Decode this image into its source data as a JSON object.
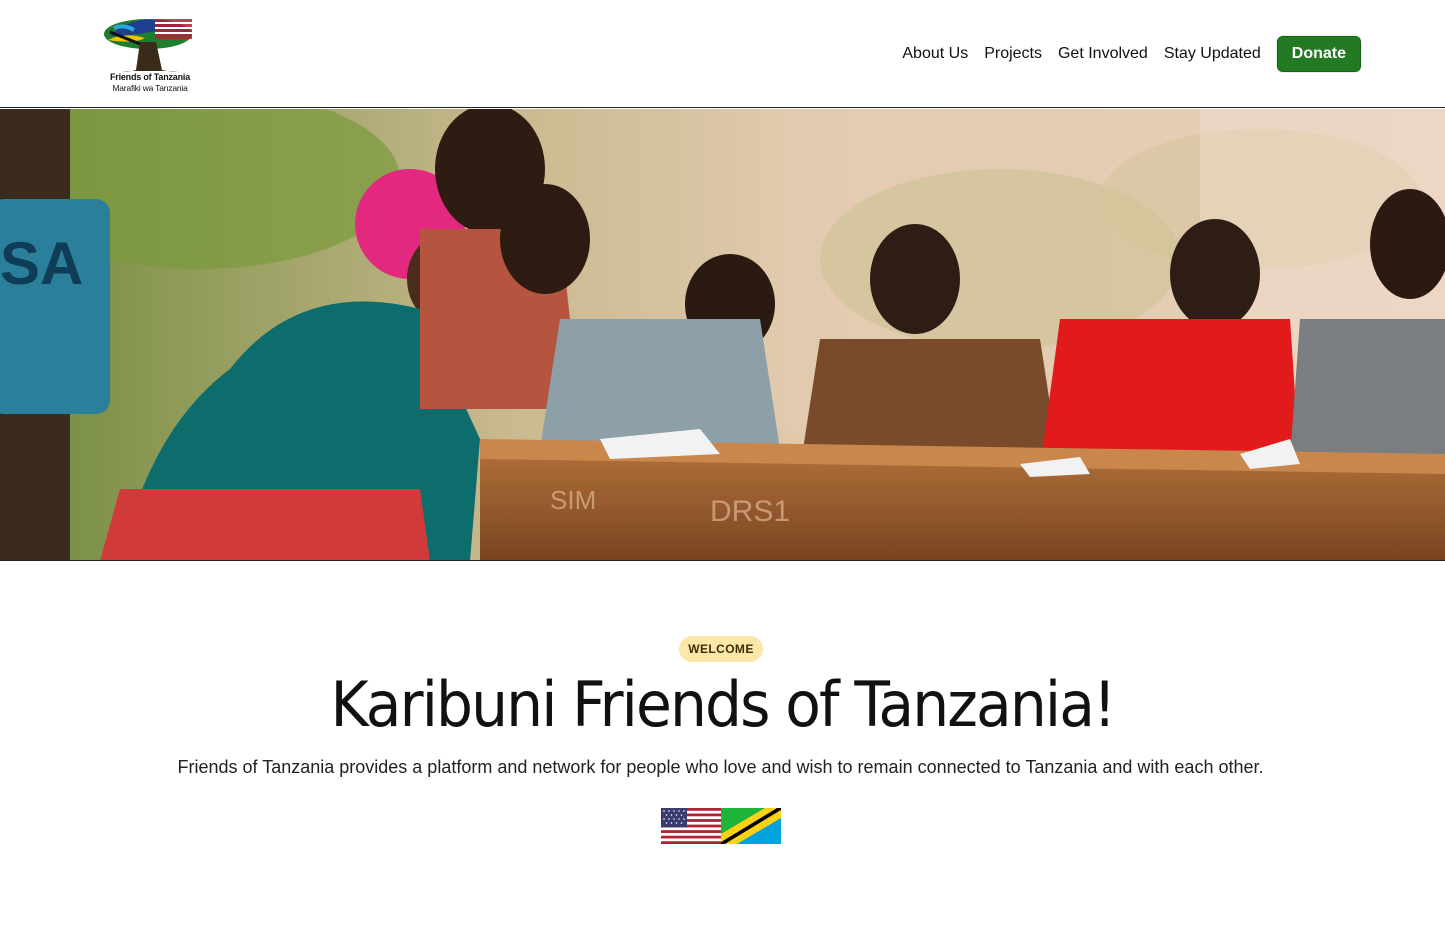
{
  "header": {
    "logo": {
      "title": "Friends of Tanzania",
      "subtitle": "Marafiki wa Tanzania",
      "icon": "baobab-tree-flag-logo"
    },
    "nav": [
      {
        "label": "About Us"
      },
      {
        "label": "Projects"
      },
      {
        "label": "Get Involved"
      },
      {
        "label": "Stay Updated"
      }
    ],
    "donate_label": "Donate"
  },
  "hero": {
    "image": "people-writing-at-outdoor-desk-photo"
  },
  "welcome": {
    "badge": "WELCOME",
    "title": "Karibuni Friends of Tanzania!",
    "subtitle": "Friends of Tanzania provides a platform and network for people who love and wish to remain connected to Tanzania and with each other.",
    "flags": [
      "us-flag-icon",
      "tanzania-flag-icon"
    ]
  },
  "colors": {
    "donate_bg": "#237a22",
    "badge_bg": "#fbe7a8",
    "divider": "#222222"
  }
}
